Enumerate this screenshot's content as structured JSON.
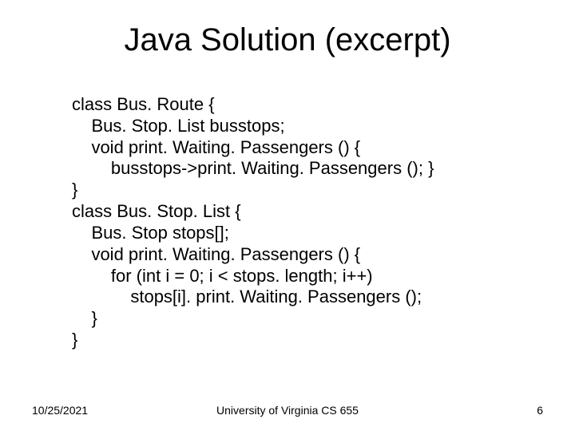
{
  "title": "Java Solution (excerpt)",
  "code": "class Bus. Route {\n    Bus. Stop. List busstops;\n    void print. Waiting. Passengers () {\n        busstops->print. Waiting. Passengers (); }\n}\nclass Bus. Stop. List {\n    Bus. Stop stops[];\n    void print. Waiting. Passengers () {\n        for (int i = 0; i < stops. length; i++)\n            stops[i]. print. Waiting. Passengers ();\n    }\n}",
  "footer": {
    "date": "10/25/2021",
    "center": "University of Virginia CS 655",
    "page": "6"
  }
}
